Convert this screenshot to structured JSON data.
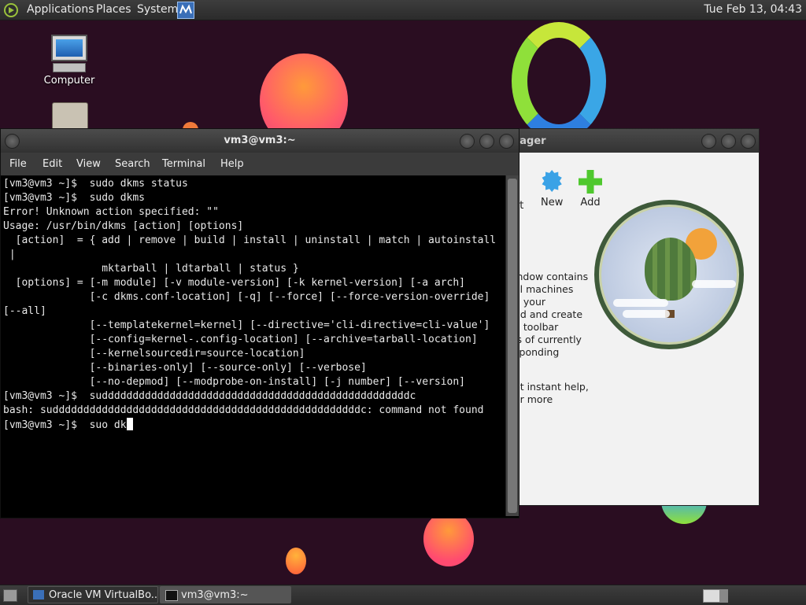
{
  "top_panel": {
    "menus": [
      "Applications",
      "Places",
      "System"
    ],
    "clock": "Tue Feb 13, 04:43"
  },
  "desktop": {
    "icons": [
      {
        "label": "Computer",
        "icon": "computer-icon"
      },
      {
        "label": "",
        "icon": "home-folder-icon"
      }
    ]
  },
  "vbox_window": {
    "title": "nager",
    "toolbar": [
      {
        "label": "ort",
        "icon": "export-icon"
      },
      {
        "label": "New",
        "icon": "new-star-icon"
      },
      {
        "label": "Add",
        "icon": "add-plus-icon"
      }
    ],
    "welcome_heading": "!",
    "welcome_lines": [
      "indow contains",
      "al machines",
      "n your",
      "dd and create",
      "g toolbar",
      "ls of currently",
      "sponding"
    ],
    "help_lines": [
      "et instant help,",
      "or more"
    ]
  },
  "terminal": {
    "title": "vm3@vm3:~",
    "menu": [
      "File",
      "Edit",
      "View",
      "Search",
      "Terminal",
      "Help"
    ],
    "lines": [
      "[vm3@vm3 ~]$  sudo dkms status",
      "[vm3@vm3 ~]$  sudo dkms",
      "Error! Unknown action specified: \"\"",
      "Usage: /usr/bin/dkms [action] [options]",
      "  [action]  = { add | remove | build | install | uninstall | match | autoinstall",
      " |",
      "                mktarball | ldtarball | status }",
      "  [options] = [-m module] [-v module-version] [-k kernel-version] [-a arch]",
      "              [-c dkms.conf-location] [-q] [--force] [--force-version-override]",
      "[--all]",
      "              [--templatekernel=kernel] [--directive='cli-directive=cli-value']",
      "              [--config=kernel-.config-location] [--archive=tarball-location]",
      "              [--kernelsourcedir=source-location]",
      "              [--binaries-only] [--source-only] [--verbose]",
      "              [--no-depmod] [--modprobe-on-install] [-j number] [--version]",
      "[vm3@vm3 ~]$  suddddddddddddddddddddddddddddddddddddddddddddddddddc",
      "bash: suddddddddddddddddddddddddddddddddddddddddddddddddddc: command not found"
    ],
    "current_input": "[vm3@vm3 ~]$  suo dk"
  },
  "taskbar": {
    "tasks": [
      {
        "label": "Oracle VM VirtualBo...",
        "icon": "virtualbox-icon"
      },
      {
        "label": "vm3@vm3:~",
        "icon": "terminal-icon"
      }
    ]
  }
}
